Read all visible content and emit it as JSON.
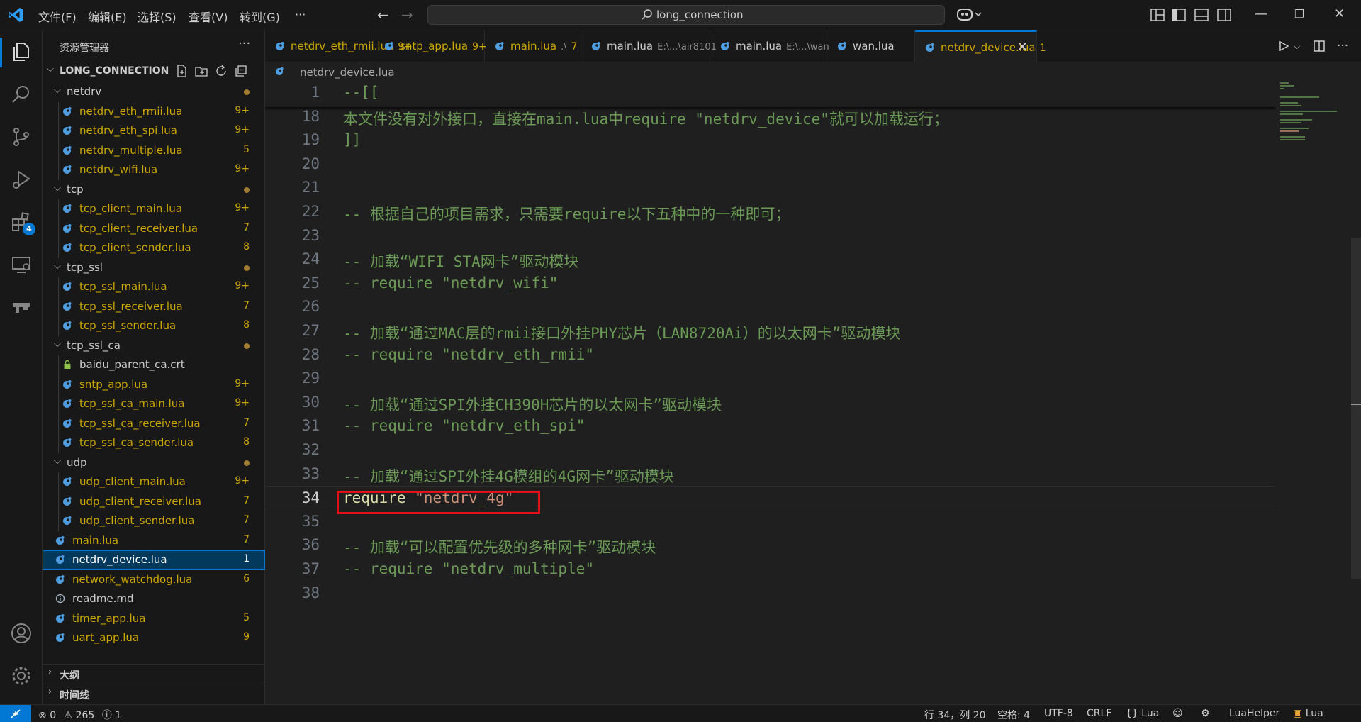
{
  "titlebar": {
    "menus": [
      "文件(F)",
      "编辑(E)",
      "选择(S)",
      "查看(V)",
      "转到(G)",
      "···"
    ],
    "search_text": "long_connection"
  },
  "activity": {
    "extensions_badge": "4"
  },
  "sidebar": {
    "title": "资源管理器",
    "more": "···",
    "folder": "LONG_CONNECTION",
    "tree": [
      {
        "label": "netdrv",
        "type": "folder",
        "depth": 1,
        "dot": true,
        "color": "#cccccc"
      },
      {
        "label": "netdrv_eth_rmii.lua",
        "type": "lua",
        "depth": 2,
        "badge": "9+",
        "color": "#cca700"
      },
      {
        "label": "netdrv_eth_spi.lua",
        "type": "lua",
        "depth": 2,
        "badge": "9+",
        "color": "#cca700"
      },
      {
        "label": "netdrv_multiple.lua",
        "type": "lua",
        "depth": 2,
        "badge": "5",
        "color": "#cca700"
      },
      {
        "label": "netdrv_wifi.lua",
        "type": "lua",
        "depth": 2,
        "badge": "9+",
        "color": "#cca700"
      },
      {
        "label": "tcp",
        "type": "folder",
        "depth": 1,
        "dot": true,
        "color": "#cccccc"
      },
      {
        "label": "tcp_client_main.lua",
        "type": "lua",
        "depth": 2,
        "badge": "9+",
        "color": "#cca700"
      },
      {
        "label": "tcp_client_receiver.lua",
        "type": "lua",
        "depth": 2,
        "badge": "7",
        "color": "#cca700"
      },
      {
        "label": "tcp_client_sender.lua",
        "type": "lua",
        "depth": 2,
        "badge": "8",
        "color": "#cca700"
      },
      {
        "label": "tcp_ssl",
        "type": "folder",
        "depth": 1,
        "dot": true,
        "color": "#cccccc"
      },
      {
        "label": "tcp_ssl_main.lua",
        "type": "lua",
        "depth": 2,
        "badge": "9+",
        "color": "#cca700"
      },
      {
        "label": "tcp_ssl_receiver.lua",
        "type": "lua",
        "depth": 2,
        "badge": "7",
        "color": "#cca700"
      },
      {
        "label": "tcp_ssl_sender.lua",
        "type": "lua",
        "depth": 2,
        "badge": "8",
        "color": "#cca700"
      },
      {
        "label": "tcp_ssl_ca",
        "type": "folder",
        "depth": 1,
        "dot": true,
        "color": "#cccccc"
      },
      {
        "label": "baidu_parent_ca.crt",
        "type": "lock",
        "depth": 2,
        "badge": "",
        "color": "#cccccc"
      },
      {
        "label": "sntp_app.lua",
        "type": "lua",
        "depth": 2,
        "badge": "9+",
        "color": "#cca700"
      },
      {
        "label": "tcp_ssl_ca_main.lua",
        "type": "lua",
        "depth": 2,
        "badge": "9+",
        "color": "#cca700"
      },
      {
        "label": "tcp_ssl_ca_receiver.lua",
        "type": "lua",
        "depth": 2,
        "badge": "7",
        "color": "#cca700"
      },
      {
        "label": "tcp_ssl_ca_sender.lua",
        "type": "lua",
        "depth": 2,
        "badge": "8",
        "color": "#cca700"
      },
      {
        "label": "udp",
        "type": "folder",
        "depth": 1,
        "dot": true,
        "color": "#cccccc"
      },
      {
        "label": "udp_client_main.lua",
        "type": "lua",
        "depth": 2,
        "badge": "9+",
        "color": "#cca700"
      },
      {
        "label": "udp_client_receiver.lua",
        "type": "lua",
        "depth": 2,
        "badge": "7",
        "color": "#cca700"
      },
      {
        "label": "udp_client_sender.lua",
        "type": "lua",
        "depth": 2,
        "badge": "7",
        "color": "#cca700"
      },
      {
        "label": "main.lua",
        "type": "lua",
        "depth": 1,
        "badge": "7",
        "color": "#cca700"
      },
      {
        "label": "netdrv_device.lua",
        "type": "lua",
        "depth": 1,
        "badge": "1",
        "color": "#ffffff",
        "selected": true
      },
      {
        "label": "network_watchdog.lua",
        "type": "lua",
        "depth": 1,
        "badge": "6",
        "color": "#cca700"
      },
      {
        "label": "readme.md",
        "type": "info",
        "depth": 1,
        "badge": "",
        "color": "#cccccc"
      },
      {
        "label": "timer_app.lua",
        "type": "lua",
        "depth": 1,
        "badge": "5",
        "color": "#cca700"
      },
      {
        "label": "uart_app.lua",
        "type": "lua",
        "depth": 1,
        "badge": "9",
        "color": "#cca700"
      }
    ],
    "outline_label": "大纲",
    "timeline_label": "时间线"
  },
  "tabs": [
    {
      "label": "netdrv_eth_rmii.lua",
      "desc": "",
      "badge": "9+",
      "active": false
    },
    {
      "label": "sntp_app.lua",
      "desc": "",
      "badge": "9+",
      "active": false
    },
    {
      "label": "main.lua",
      "desc": ".\\",
      "badge": "7",
      "active": false
    },
    {
      "label": "main.lua",
      "desc": "E:\\...\\air8101",
      "badge": "",
      "active": false
    },
    {
      "label": "main.lua",
      "desc": "E:\\...\\wan",
      "badge": "",
      "active": false
    },
    {
      "label": "wan.lua",
      "desc": "",
      "badge": "",
      "active": false
    },
    {
      "label": "netdrv_device.lua",
      "desc": "",
      "badge": "1",
      "active": true
    }
  ],
  "tab_close": "✕",
  "breadcrumb": {
    "file": "netdrv_device.lua"
  },
  "editor": {
    "lines": [
      {
        "n": "1",
        "text": "--[[",
        "kind": "comment"
      },
      {
        "n": "18",
        "text": "本文件没有对外接口，直接在main.lua中require \"netdrv_device\"就可以加载运行；",
        "kind": "comment"
      },
      {
        "n": "19",
        "text": "]]",
        "kind": "comment"
      },
      {
        "n": "20",
        "text": "",
        "kind": "plain"
      },
      {
        "n": "21",
        "text": "",
        "kind": "plain"
      },
      {
        "n": "22",
        "text": "-- 根据自己的项目需求，只需要require以下五种中的一种即可；",
        "kind": "comment"
      },
      {
        "n": "23",
        "text": "",
        "kind": "plain"
      },
      {
        "n": "24",
        "text": "-- 加载“WIFI STA网卡”驱动模块",
        "kind": "comment"
      },
      {
        "n": "25",
        "text": "-- require \"netdrv_wifi\"",
        "kind": "comment"
      },
      {
        "n": "26",
        "text": "",
        "kind": "plain"
      },
      {
        "n": "27",
        "text": "-- 加载“通过MAC层的rmii接口外挂PHY芯片（LAN8720Ai）的以太网卡”驱动模块",
        "kind": "comment"
      },
      {
        "n": "28",
        "text": "-- require \"netdrv_eth_rmii\"",
        "kind": "comment"
      },
      {
        "n": "29",
        "text": "",
        "kind": "plain"
      },
      {
        "n": "30",
        "text": "-- 加载“通过SPI外挂CH390H芯片的以太网卡”驱动模块",
        "kind": "comment"
      },
      {
        "n": "31",
        "text": "-- require \"netdrv_eth_spi\"",
        "kind": "comment"
      },
      {
        "n": "32",
        "text": "",
        "kind": "plain"
      },
      {
        "n": "33",
        "text": "-- 加载“通过SPI外挂4G模组的4G网卡”驱动模块",
        "kind": "comment"
      },
      {
        "n": "34",
        "kw": "require",
        "str": " \"netdrv_4g\"",
        "kind": "code",
        "current": true
      },
      {
        "n": "35",
        "text": "",
        "kind": "plain"
      },
      {
        "n": "36",
        "text": "-- 加载“可以配置优先级的多种网卡”驱动模块",
        "kind": "comment"
      },
      {
        "n": "37",
        "text": "-- require \"netdrv_multiple\"",
        "kind": "comment"
      },
      {
        "n": "38",
        "text": "",
        "kind": "plain"
      }
    ]
  },
  "statusbar": {
    "errors": "0",
    "warnings": "265",
    "infos": "1",
    "cursor": "行 34，列 20",
    "spaces": "空格: 4",
    "encoding": "UTF-8",
    "eol": "CRLF",
    "language": "Lua",
    "helper": "LuaHelper",
    "lua_ext": "Lua"
  }
}
